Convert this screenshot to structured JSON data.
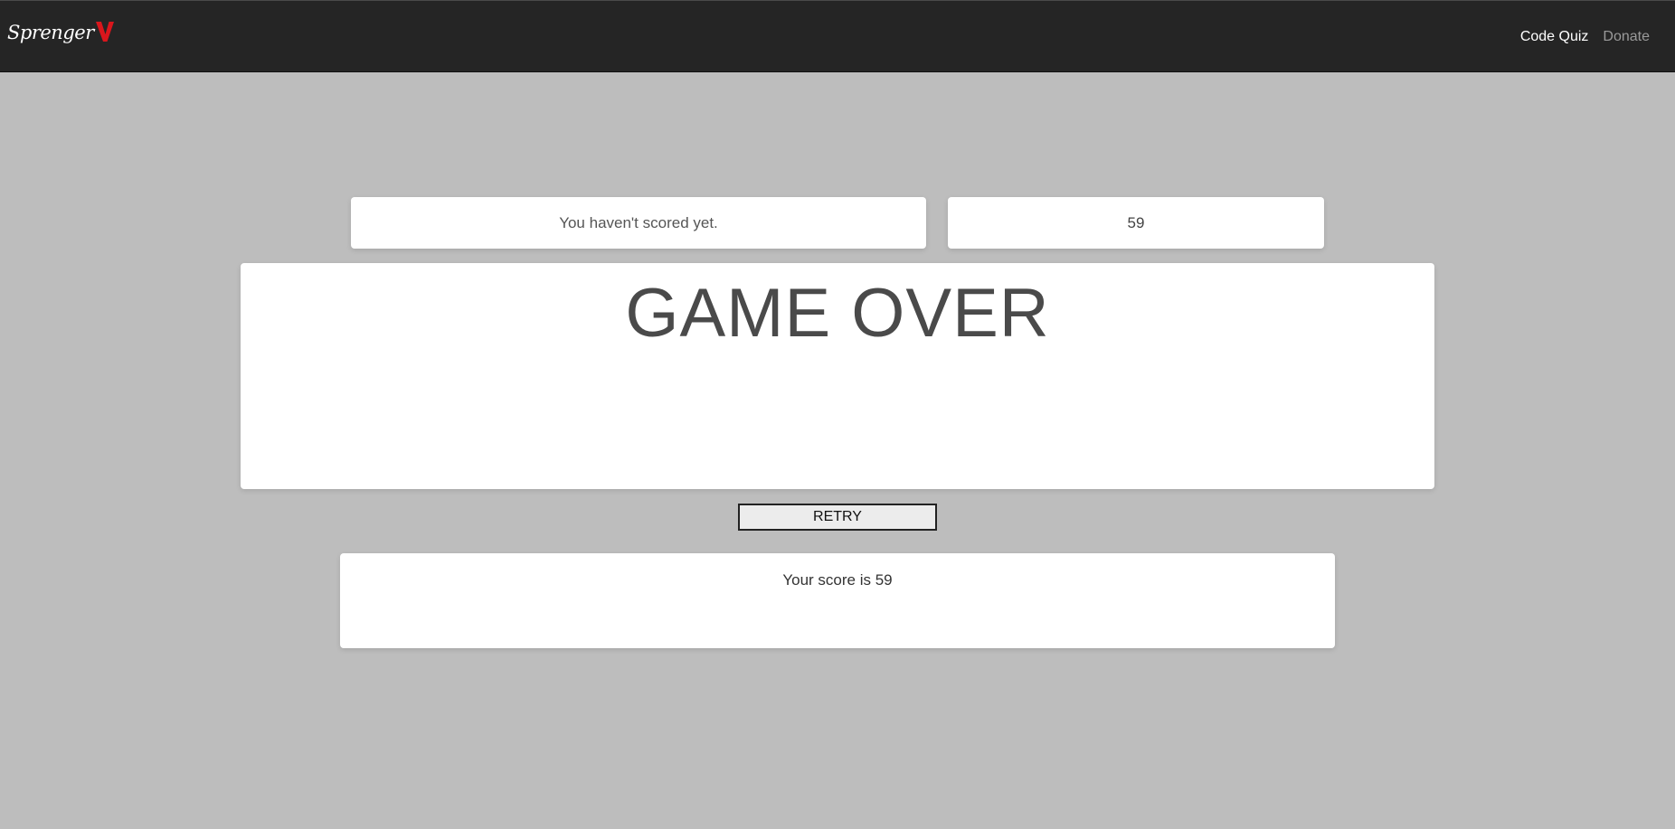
{
  "navbar": {
    "brand_text": "Sprenger",
    "brand_mark_icon": "red-v-logo-icon",
    "brand_mark_color": "#d9161c",
    "background_color": "#252525",
    "links": [
      {
        "label": "Code Quiz",
        "state": "active"
      },
      {
        "label": "Donate",
        "state": "inactive"
      }
    ]
  },
  "status": {
    "message": "You haven't scored yet."
  },
  "timer": {
    "value": "59"
  },
  "question": {
    "title": "GAME OVER"
  },
  "actions": {
    "retry_label": "RETRY"
  },
  "result": {
    "text": "Your score is 59"
  },
  "colors": {
    "page_background": "#bdbdbd",
    "card_background": "#ffffff"
  }
}
